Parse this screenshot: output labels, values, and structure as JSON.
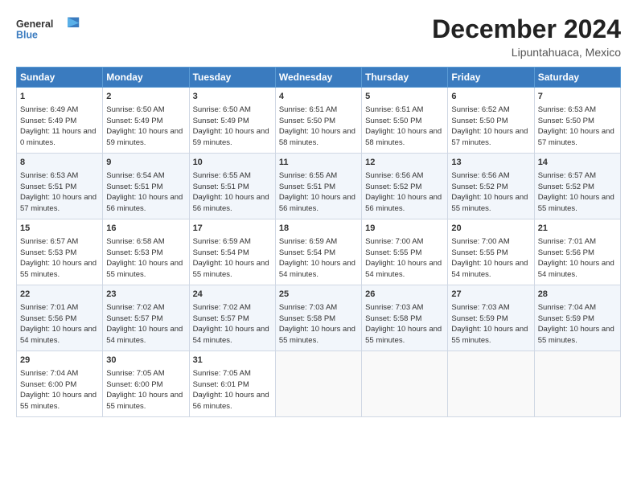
{
  "header": {
    "logo_general": "General",
    "logo_blue": "Blue",
    "title": "December 2024",
    "location": "Lipuntahuaca, Mexico"
  },
  "columns": [
    "Sunday",
    "Monday",
    "Tuesday",
    "Wednesday",
    "Thursday",
    "Friday",
    "Saturday"
  ],
  "weeks": [
    [
      {
        "day": "1",
        "rise": "6:49 AM",
        "set": "5:49 PM",
        "daylight": "11 hours and 0 minutes."
      },
      {
        "day": "2",
        "rise": "6:50 AM",
        "set": "5:49 PM",
        "daylight": "10 hours and 59 minutes."
      },
      {
        "day": "3",
        "rise": "6:50 AM",
        "set": "5:49 PM",
        "daylight": "10 hours and 59 minutes."
      },
      {
        "day": "4",
        "rise": "6:51 AM",
        "set": "5:50 PM",
        "daylight": "10 hours and 58 minutes."
      },
      {
        "day": "5",
        "rise": "6:51 AM",
        "set": "5:50 PM",
        "daylight": "10 hours and 58 minutes."
      },
      {
        "day": "6",
        "rise": "6:52 AM",
        "set": "5:50 PM",
        "daylight": "10 hours and 57 minutes."
      },
      {
        "day": "7",
        "rise": "6:53 AM",
        "set": "5:50 PM",
        "daylight": "10 hours and 57 minutes."
      }
    ],
    [
      {
        "day": "8",
        "rise": "6:53 AM",
        "set": "5:51 PM",
        "daylight": "10 hours and 57 minutes."
      },
      {
        "day": "9",
        "rise": "6:54 AM",
        "set": "5:51 PM",
        "daylight": "10 hours and 56 minutes."
      },
      {
        "day": "10",
        "rise": "6:55 AM",
        "set": "5:51 PM",
        "daylight": "10 hours and 56 minutes."
      },
      {
        "day": "11",
        "rise": "6:55 AM",
        "set": "5:51 PM",
        "daylight": "10 hours and 56 minutes."
      },
      {
        "day": "12",
        "rise": "6:56 AM",
        "set": "5:52 PM",
        "daylight": "10 hours and 56 minutes."
      },
      {
        "day": "13",
        "rise": "6:56 AM",
        "set": "5:52 PM",
        "daylight": "10 hours and 55 minutes."
      },
      {
        "day": "14",
        "rise": "6:57 AM",
        "set": "5:52 PM",
        "daylight": "10 hours and 55 minutes."
      }
    ],
    [
      {
        "day": "15",
        "rise": "6:57 AM",
        "set": "5:53 PM",
        "daylight": "10 hours and 55 minutes."
      },
      {
        "day": "16",
        "rise": "6:58 AM",
        "set": "5:53 PM",
        "daylight": "10 hours and 55 minutes."
      },
      {
        "day": "17",
        "rise": "6:59 AM",
        "set": "5:54 PM",
        "daylight": "10 hours and 55 minutes."
      },
      {
        "day": "18",
        "rise": "6:59 AM",
        "set": "5:54 PM",
        "daylight": "10 hours and 54 minutes."
      },
      {
        "day": "19",
        "rise": "7:00 AM",
        "set": "5:55 PM",
        "daylight": "10 hours and 54 minutes."
      },
      {
        "day": "20",
        "rise": "7:00 AM",
        "set": "5:55 PM",
        "daylight": "10 hours and 54 minutes."
      },
      {
        "day": "21",
        "rise": "7:01 AM",
        "set": "5:56 PM",
        "daylight": "10 hours and 54 minutes."
      }
    ],
    [
      {
        "day": "22",
        "rise": "7:01 AM",
        "set": "5:56 PM",
        "daylight": "10 hours and 54 minutes."
      },
      {
        "day": "23",
        "rise": "7:02 AM",
        "set": "5:57 PM",
        "daylight": "10 hours and 54 minutes."
      },
      {
        "day": "24",
        "rise": "7:02 AM",
        "set": "5:57 PM",
        "daylight": "10 hours and 54 minutes."
      },
      {
        "day": "25",
        "rise": "7:03 AM",
        "set": "5:58 PM",
        "daylight": "10 hours and 55 minutes."
      },
      {
        "day": "26",
        "rise": "7:03 AM",
        "set": "5:58 PM",
        "daylight": "10 hours and 55 minutes."
      },
      {
        "day": "27",
        "rise": "7:03 AM",
        "set": "5:59 PM",
        "daylight": "10 hours and 55 minutes."
      },
      {
        "day": "28",
        "rise": "7:04 AM",
        "set": "5:59 PM",
        "daylight": "10 hours and 55 minutes."
      }
    ],
    [
      {
        "day": "29",
        "rise": "7:04 AM",
        "set": "6:00 PM",
        "daylight": "10 hours and 55 minutes."
      },
      {
        "day": "30",
        "rise": "7:05 AM",
        "set": "6:00 PM",
        "daylight": "10 hours and 55 minutes."
      },
      {
        "day": "31",
        "rise": "7:05 AM",
        "set": "6:01 PM",
        "daylight": "10 hours and 56 minutes."
      },
      null,
      null,
      null,
      null
    ]
  ],
  "labels": {
    "sunrise": "Sunrise:",
    "sunset": "Sunset:",
    "daylight": "Daylight:"
  }
}
